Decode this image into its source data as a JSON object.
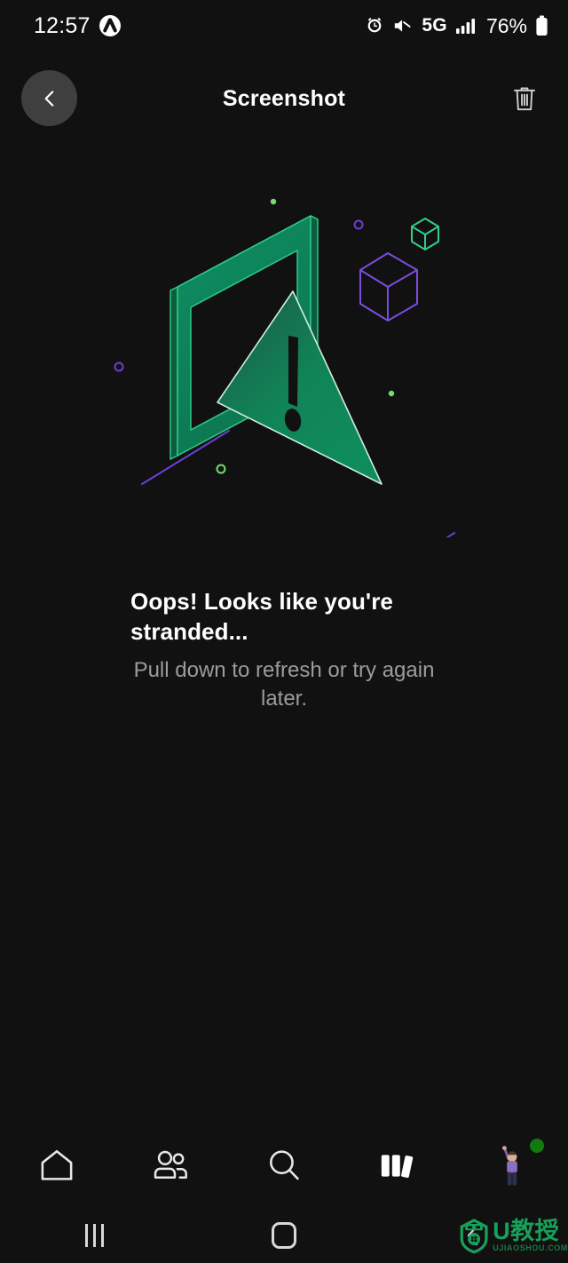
{
  "status_bar": {
    "time": "12:57",
    "app_glyph": "xbox-logo-icon",
    "icons": [
      "alarm-icon",
      "mute-icon",
      "signal-icon",
      "battery-icon"
    ],
    "network": "5G",
    "battery_percent": "76%"
  },
  "header": {
    "title": "Screenshot",
    "back_label": "Back",
    "delete_label": "Delete"
  },
  "illustration": {
    "name": "stranded-error-illustration",
    "description": "Isometric screen frame with warning triangle",
    "colors": {
      "green_fill": "#107C55",
      "green_line": "#15a06b",
      "green_light": "#9fe5b5",
      "purple_line": "#6C3FD6",
      "background": "#111111"
    }
  },
  "message": {
    "title": "Oops! Looks like you're stranded...",
    "subtitle": "Pull down to refresh or try again later."
  },
  "tab_bar": {
    "items": [
      {
        "name": "home",
        "icon": "home-icon",
        "label": "Home"
      },
      {
        "name": "social",
        "icon": "people-icon",
        "label": "Social"
      },
      {
        "name": "search",
        "icon": "search-icon",
        "label": "Search"
      },
      {
        "name": "library",
        "icon": "library-icon",
        "label": "Library"
      },
      {
        "name": "profile",
        "icon": "avatar-icon",
        "label": "Profile"
      }
    ],
    "presence": "online",
    "presence_color": "#107C10"
  },
  "nav_bar": {
    "recents_label": "Recents",
    "home_label": "Home",
    "back_label": "Back"
  },
  "watermark": {
    "main": "U教授",
    "sub": "UJIAOSHOU.COM",
    "color": "#18a05a"
  }
}
